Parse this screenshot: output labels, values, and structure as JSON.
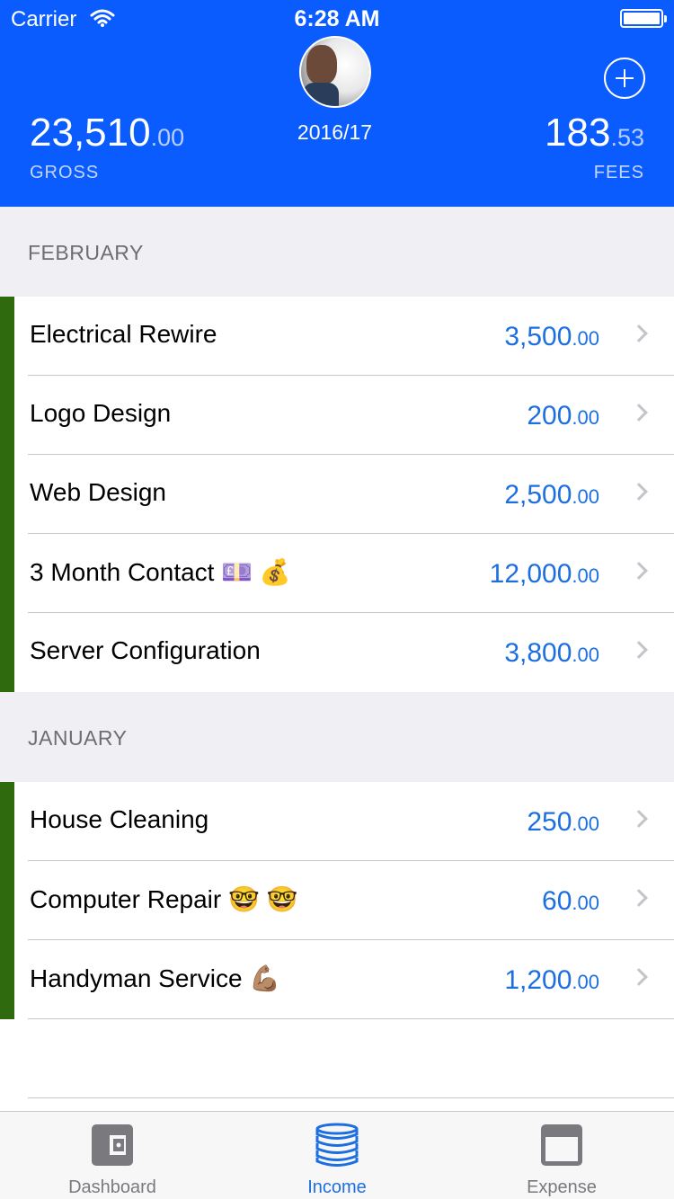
{
  "status_bar": {
    "carrier": "Carrier",
    "time": "6:28 AM"
  },
  "header": {
    "gross_whole": "23,510",
    "gross_decimal": ".00",
    "gross_label": "GROSS",
    "tax_year": "2016/17",
    "fees_whole": "183",
    "fees_decimal": ".53",
    "fees_label": "FEES"
  },
  "colors": {
    "header_bg": "#0A5CFF",
    "accent": "#1D6FE0",
    "row_marker": "#2F6A0E",
    "section_bg": "#EFEFF4"
  },
  "sections": [
    {
      "title": "FEBRUARY",
      "rows": [
        {
          "title": "Electrical Rewire",
          "amount_whole": "3,500",
          "amount_decimal": ".00"
        },
        {
          "title": "Logo Design",
          "amount_whole": "200",
          "amount_decimal": ".00"
        },
        {
          "title": "Web Design",
          "amount_whole": "2,500",
          "amount_decimal": ".00"
        },
        {
          "title": "3 Month Contact 💷 💰",
          "amount_whole": "12,000",
          "amount_decimal": ".00"
        },
        {
          "title": "Server Configuration",
          "amount_whole": "3,800",
          "amount_decimal": ".00"
        }
      ]
    },
    {
      "title": "JANUARY",
      "rows": [
        {
          "title": "House Cleaning",
          "amount_whole": "250",
          "amount_decimal": ".00"
        },
        {
          "title": "Computer Repair 🤓 🤓",
          "amount_whole": "60",
          "amount_decimal": ".00"
        },
        {
          "title": "Handyman Service 💪🏽",
          "amount_whole": "1,200",
          "amount_decimal": ".00"
        }
      ]
    }
  ],
  "tabs": [
    {
      "label": "Dashboard",
      "icon": "wallet-icon"
    },
    {
      "label": "Income",
      "icon": "coins-stack-icon",
      "selected": true
    },
    {
      "label": "Expense",
      "icon": "credit-card-icon"
    }
  ]
}
